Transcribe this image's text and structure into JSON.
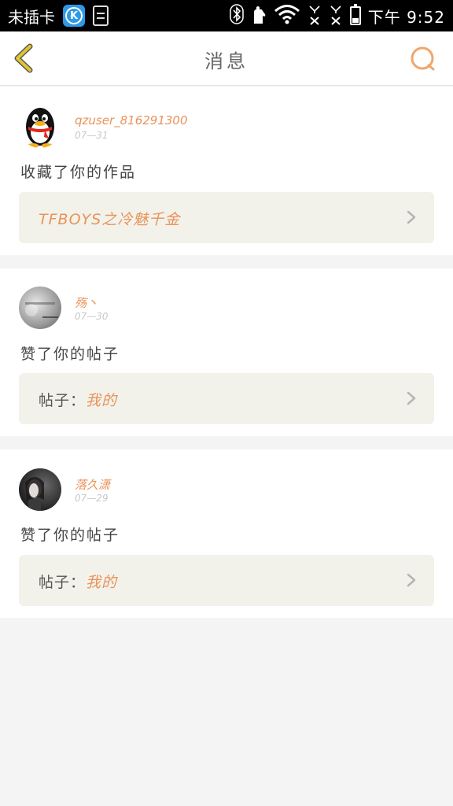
{
  "status_bar": {
    "carrier": "未插卡",
    "app_k_label": "K",
    "sim1": "1",
    "sim2": "2",
    "time": "下午 9:52"
  },
  "header": {
    "title": "消息"
  },
  "colors": {
    "accent": "#e8935a",
    "back_icon": "#e0c531",
    "card_bg": "#ffffff",
    "page_bg": "#f4f4f4",
    "target_bg": "#f3f2ea"
  },
  "messages": [
    {
      "username": "qzuser_816291300",
      "date": "07—31",
      "action": "收藏了你的作品",
      "target_prefix": "",
      "target_link": "TFBOYS之冷魅千金"
    },
    {
      "username": "殇丶",
      "date": "07—30",
      "action": "赞了你的帖子",
      "target_prefix": "帖子：",
      "target_link": "我的"
    },
    {
      "username": "落久潇",
      "date": "07—29",
      "action": "赞了你的帖子",
      "target_prefix": "帖子：",
      "target_link": "我的"
    }
  ]
}
